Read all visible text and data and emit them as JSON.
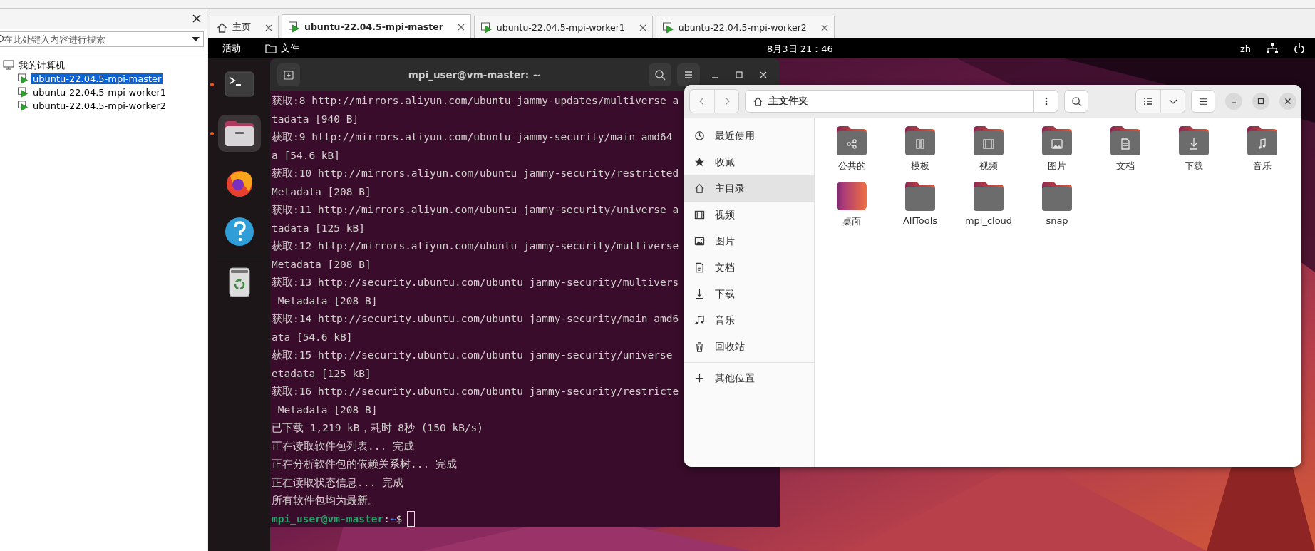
{
  "app_panel": {
    "search": {
      "placeholder": "在此处键入内容进行搜索"
    },
    "tree": [
      {
        "label": "我的计算机",
        "selected": false,
        "children": [
          {
            "label": "ubuntu-22.04.5-mpi-master",
            "selected": true
          },
          {
            "label": "ubuntu-22.04.5-mpi-worker1",
            "selected": false
          },
          {
            "label": "ubuntu-22.04.5-mpi-worker2",
            "selected": false
          }
        ]
      }
    ]
  },
  "tabs": [
    {
      "kind": "home",
      "label": "主页",
      "selected": false
    },
    {
      "kind": "vm",
      "label": "ubuntu-22.04.5-mpi-master",
      "selected": true
    },
    {
      "kind": "vm",
      "label": "ubuntu-22.04.5-mpi-worker1",
      "selected": false
    },
    {
      "kind": "vm",
      "label": "ubuntu-22.04.5-mpi-worker2",
      "selected": false
    }
  ],
  "ubuntu_top_bar": {
    "activities": "活动",
    "app_menu": "文件",
    "clock": "8月3日 21：46",
    "input_method": "zh"
  },
  "dock": [
    {
      "kind": "terminal",
      "running": true,
      "active": false
    },
    {
      "kind": "files",
      "running": true,
      "active": true
    },
    {
      "kind": "firefox",
      "running": false,
      "active": false
    },
    {
      "kind": "help",
      "running": false,
      "active": false
    },
    {
      "kind": "trash",
      "running": false,
      "active": false
    }
  ],
  "terminal": {
    "title": "mpi_user@vm-master: ~",
    "lines": [
      "获取:8 http://mirrors.aliyun.com/ubuntu jammy-updates/multiverse a",
      "tadata [940 B]",
      "获取:9 http://mirrors.aliyun.com/ubuntu jammy-security/main amd64",
      "a [54.6 kB]",
      "获取:10 http://mirrors.aliyun.com/ubuntu jammy-security/restricted",
      "Metadata [208 B]",
      "获取:11 http://mirrors.aliyun.com/ubuntu jammy-security/universe a",
      "tadata [125 kB]",
      "获取:12 http://mirrors.aliyun.com/ubuntu jammy-security/multiverse",
      "Metadata [208 B]",
      "获取:13 http://security.ubuntu.com/ubuntu jammy-security/multivers",
      " Metadata [208 B]",
      "获取:14 http://security.ubuntu.com/ubuntu jammy-security/main amd6",
      "ata [54.6 kB]",
      "获取:15 http://security.ubuntu.com/ubuntu jammy-security/universe",
      "etadata [125 kB]",
      "获取:16 http://security.ubuntu.com/ubuntu jammy-security/restricte",
      " Metadata [208 B]",
      "已下载 1,219 kB，耗时 8秒 (150 kB/s)",
      "正在读取软件包列表... 完成",
      "正在分析软件包的依赖关系树... 完成",
      "正在读取状态信息... 完成",
      "所有软件包均为最新。"
    ],
    "prompt": {
      "user_host": "mpi_user@vm-master",
      "separator": ":",
      "path": "~",
      "symbol": "$"
    }
  },
  "file_manager": {
    "path": "主文件夹",
    "sidebar": [
      {
        "kind": "recent",
        "label": "最近使用",
        "selected": false
      },
      {
        "kind": "starred",
        "label": "收藏",
        "selected": false
      },
      {
        "kind": "home",
        "label": "主目录",
        "selected": true
      },
      {
        "kind": "videos",
        "label": "视频",
        "selected": false
      },
      {
        "kind": "pictures",
        "label": "图片",
        "selected": false
      },
      {
        "kind": "documents",
        "label": "文档",
        "selected": false
      },
      {
        "kind": "downloads",
        "label": "下载",
        "selected": false
      },
      {
        "kind": "music",
        "label": "音乐",
        "selected": false
      },
      {
        "kind": "trash",
        "label": "回收站",
        "selected": false
      },
      {
        "kind": "other",
        "label": "其他位置",
        "selected": false
      }
    ],
    "folders": [
      {
        "kind": "public",
        "label": "公共的"
      },
      {
        "kind": "templates",
        "label": "模板"
      },
      {
        "kind": "videos",
        "label": "视频"
      },
      {
        "kind": "pictures",
        "label": "图片"
      },
      {
        "kind": "documents",
        "label": "文档"
      },
      {
        "kind": "downloads",
        "label": "下载"
      },
      {
        "kind": "music",
        "label": "音乐"
      },
      {
        "kind": "desktop",
        "label": "桌面"
      },
      {
        "kind": "plain",
        "label": "AllTools"
      },
      {
        "kind": "plain",
        "label": "mpi_cloud"
      },
      {
        "kind": "plain",
        "label": "snap"
      }
    ]
  }
}
